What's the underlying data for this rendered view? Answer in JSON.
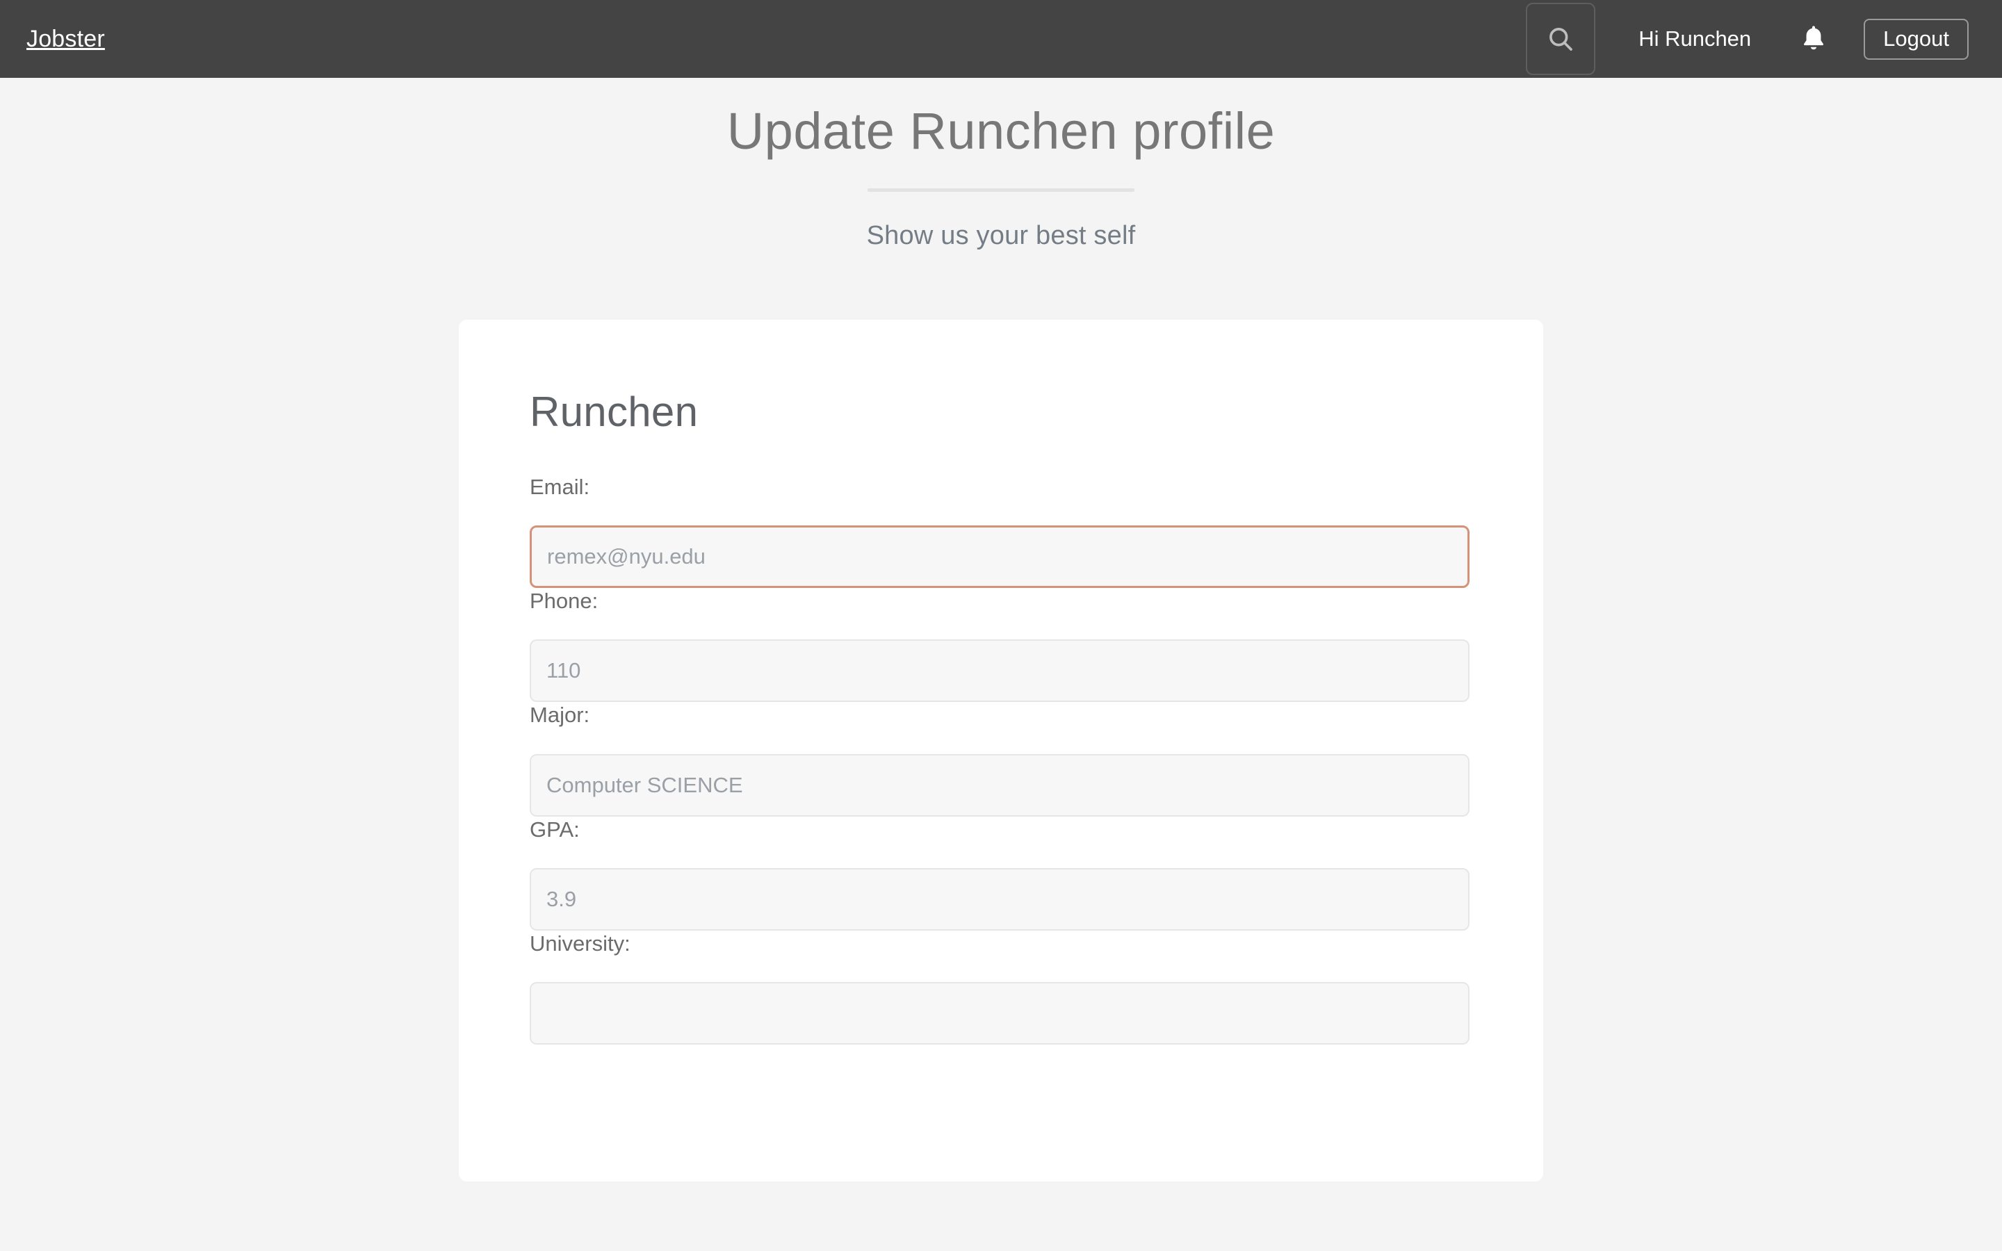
{
  "navbar": {
    "brand": "Jobster",
    "search_icon": "search-icon",
    "greeting": "Hi Runchen",
    "bell_icon": "bell-icon",
    "logout_label": "Logout"
  },
  "header": {
    "title": "Update Runchen profile",
    "subtitle": "Show us your best self"
  },
  "card": {
    "title": "Runchen",
    "fields": [
      {
        "label": "Email:",
        "value": "",
        "placeholder": "remex@nyu.edu",
        "focused": true
      },
      {
        "label": "Phone:",
        "value": "",
        "placeholder": "110",
        "focused": false
      },
      {
        "label": "Major:",
        "value": "",
        "placeholder": "Computer SCIENCE",
        "focused": false
      },
      {
        "label": "GPA:",
        "value": "",
        "placeholder": "3.9",
        "focused": false
      },
      {
        "label": "University:",
        "value": "",
        "placeholder": "",
        "focused": false
      }
    ]
  },
  "colors": {
    "navbar_bg": "#444444",
    "page_bg": "#f4f4f4",
    "card_bg": "#ffffff",
    "accent_focus": "#d4927a",
    "input_bg": "#f7f7f7",
    "text_muted": "#777777"
  }
}
